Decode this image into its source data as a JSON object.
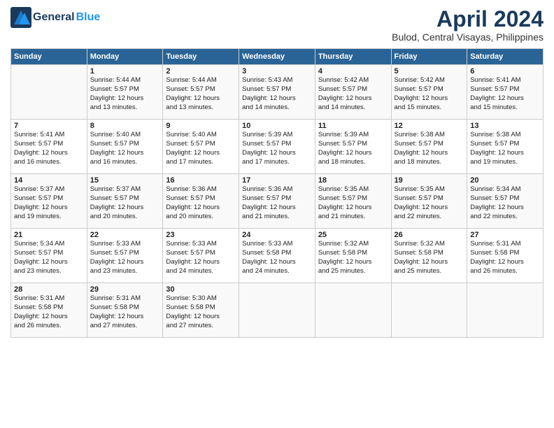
{
  "logo": {
    "general": "General",
    "blue": "Blue"
  },
  "title": "April 2024",
  "subtitle": "Bulod, Central Visayas, Philippines",
  "days_of_week": [
    "Sunday",
    "Monday",
    "Tuesday",
    "Wednesday",
    "Thursday",
    "Friday",
    "Saturday"
  ],
  "weeks": [
    [
      {
        "day": "",
        "content": ""
      },
      {
        "day": "1",
        "content": "Sunrise: 5:44 AM\nSunset: 5:57 PM\nDaylight: 12 hours\nand 13 minutes."
      },
      {
        "day": "2",
        "content": "Sunrise: 5:44 AM\nSunset: 5:57 PM\nDaylight: 12 hours\nand 13 minutes."
      },
      {
        "day": "3",
        "content": "Sunrise: 5:43 AM\nSunset: 5:57 PM\nDaylight: 12 hours\nand 14 minutes."
      },
      {
        "day": "4",
        "content": "Sunrise: 5:42 AM\nSunset: 5:57 PM\nDaylight: 12 hours\nand 14 minutes."
      },
      {
        "day": "5",
        "content": "Sunrise: 5:42 AM\nSunset: 5:57 PM\nDaylight: 12 hours\nand 15 minutes."
      },
      {
        "day": "6",
        "content": "Sunrise: 5:41 AM\nSunset: 5:57 PM\nDaylight: 12 hours\nand 15 minutes."
      }
    ],
    [
      {
        "day": "7",
        "content": "Sunrise: 5:41 AM\nSunset: 5:57 PM\nDaylight: 12 hours\nand 16 minutes."
      },
      {
        "day": "8",
        "content": "Sunrise: 5:40 AM\nSunset: 5:57 PM\nDaylight: 12 hours\nand 16 minutes."
      },
      {
        "day": "9",
        "content": "Sunrise: 5:40 AM\nSunset: 5:57 PM\nDaylight: 12 hours\nand 17 minutes."
      },
      {
        "day": "10",
        "content": "Sunrise: 5:39 AM\nSunset: 5:57 PM\nDaylight: 12 hours\nand 17 minutes."
      },
      {
        "day": "11",
        "content": "Sunrise: 5:39 AM\nSunset: 5:57 PM\nDaylight: 12 hours\nand 18 minutes."
      },
      {
        "day": "12",
        "content": "Sunrise: 5:38 AM\nSunset: 5:57 PM\nDaylight: 12 hours\nand 18 minutes."
      },
      {
        "day": "13",
        "content": "Sunrise: 5:38 AM\nSunset: 5:57 PM\nDaylight: 12 hours\nand 19 minutes."
      }
    ],
    [
      {
        "day": "14",
        "content": "Sunrise: 5:37 AM\nSunset: 5:57 PM\nDaylight: 12 hours\nand 19 minutes."
      },
      {
        "day": "15",
        "content": "Sunrise: 5:37 AM\nSunset: 5:57 PM\nDaylight: 12 hours\nand 20 minutes."
      },
      {
        "day": "16",
        "content": "Sunrise: 5:36 AM\nSunset: 5:57 PM\nDaylight: 12 hours\nand 20 minutes."
      },
      {
        "day": "17",
        "content": "Sunrise: 5:36 AM\nSunset: 5:57 PM\nDaylight: 12 hours\nand 21 minutes."
      },
      {
        "day": "18",
        "content": "Sunrise: 5:35 AM\nSunset: 5:57 PM\nDaylight: 12 hours\nand 21 minutes."
      },
      {
        "day": "19",
        "content": "Sunrise: 5:35 AM\nSunset: 5:57 PM\nDaylight: 12 hours\nand 22 minutes."
      },
      {
        "day": "20",
        "content": "Sunrise: 5:34 AM\nSunset: 5:57 PM\nDaylight: 12 hours\nand 22 minutes."
      }
    ],
    [
      {
        "day": "21",
        "content": "Sunrise: 5:34 AM\nSunset: 5:57 PM\nDaylight: 12 hours\nand 23 minutes."
      },
      {
        "day": "22",
        "content": "Sunrise: 5:33 AM\nSunset: 5:57 PM\nDaylight: 12 hours\nand 23 minutes."
      },
      {
        "day": "23",
        "content": "Sunrise: 5:33 AM\nSunset: 5:57 PM\nDaylight: 12 hours\nand 24 minutes."
      },
      {
        "day": "24",
        "content": "Sunrise: 5:33 AM\nSunset: 5:58 PM\nDaylight: 12 hours\nand 24 minutes."
      },
      {
        "day": "25",
        "content": "Sunrise: 5:32 AM\nSunset: 5:58 PM\nDaylight: 12 hours\nand 25 minutes."
      },
      {
        "day": "26",
        "content": "Sunrise: 5:32 AM\nSunset: 5:58 PM\nDaylight: 12 hours\nand 25 minutes."
      },
      {
        "day": "27",
        "content": "Sunrise: 5:31 AM\nSunset: 5:58 PM\nDaylight: 12 hours\nand 26 minutes."
      }
    ],
    [
      {
        "day": "28",
        "content": "Sunrise: 5:31 AM\nSunset: 5:58 PM\nDaylight: 12 hours\nand 26 minutes."
      },
      {
        "day": "29",
        "content": "Sunrise: 5:31 AM\nSunset: 5:58 PM\nDaylight: 12 hours\nand 27 minutes."
      },
      {
        "day": "30",
        "content": "Sunrise: 5:30 AM\nSunset: 5:58 PM\nDaylight: 12 hours\nand 27 minutes."
      },
      {
        "day": "",
        "content": ""
      },
      {
        "day": "",
        "content": ""
      },
      {
        "day": "",
        "content": ""
      },
      {
        "day": "",
        "content": ""
      }
    ]
  ]
}
